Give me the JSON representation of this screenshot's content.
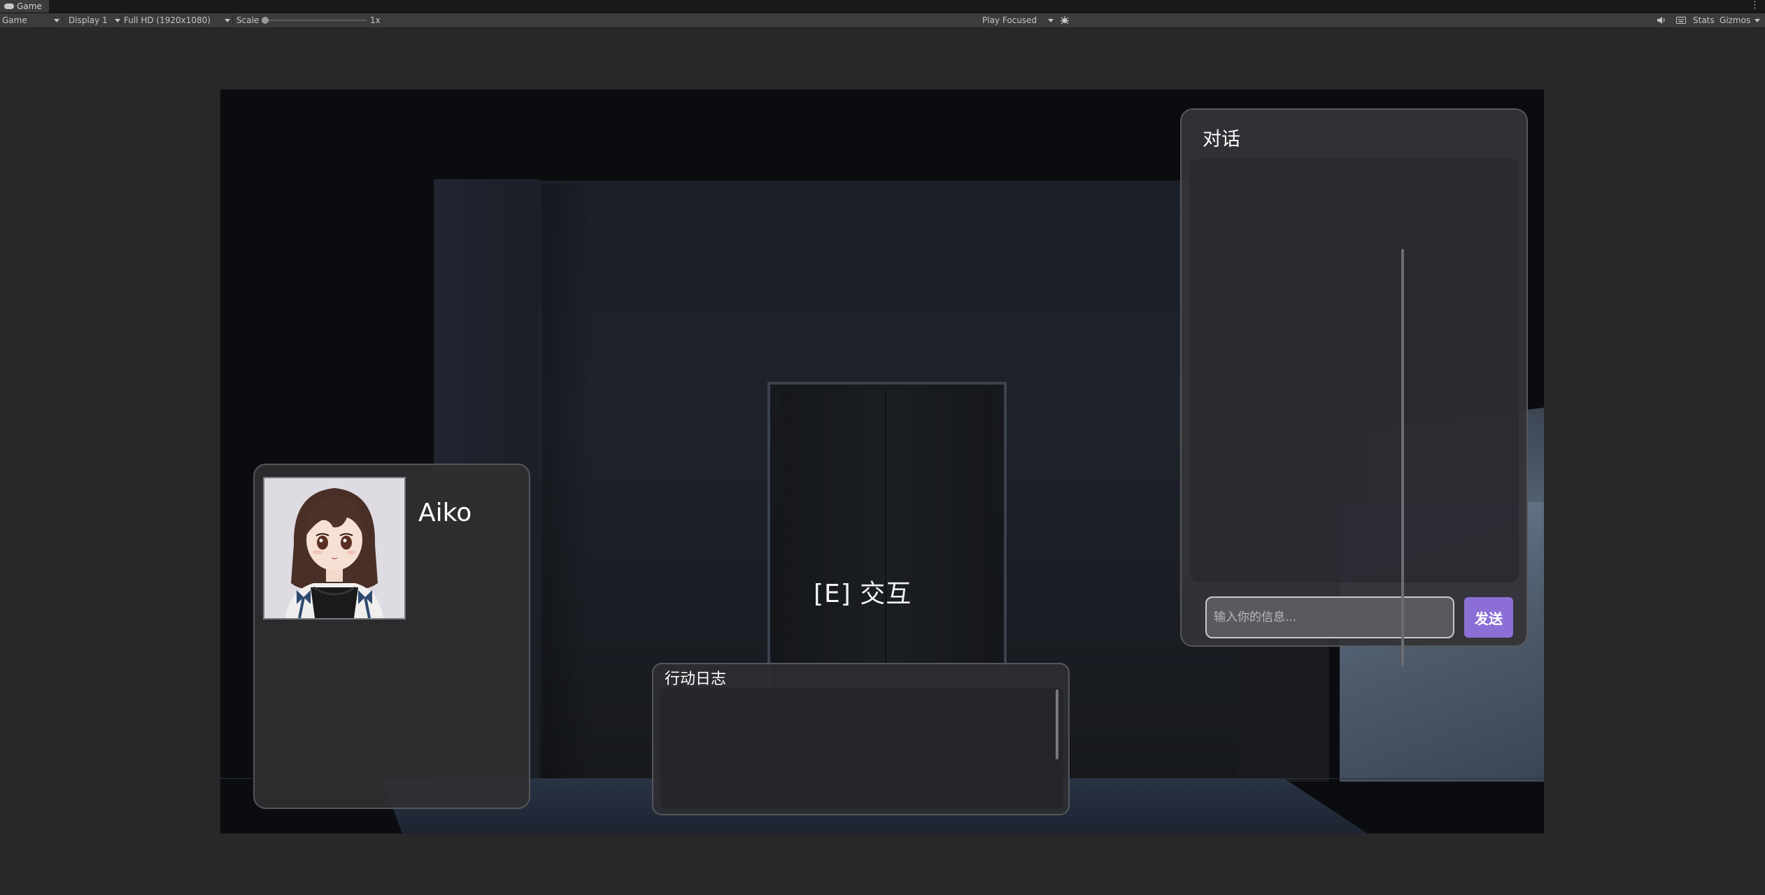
{
  "window": {
    "tab_title": "Game",
    "tab_icon": "gamepad-icon",
    "menu_glyph": "⋮"
  },
  "toolbar": {
    "view_mode": "Game",
    "display": "Display 1",
    "resolution": "Full HD (1920x1080)",
    "scale_label": "Scale",
    "scale_value": "1x",
    "play_mode": "Play Focused",
    "stats_label": "Stats",
    "gizmos_label": "Gizmos"
  },
  "game": {
    "interact_prompt": "[E] 交互",
    "character": {
      "name": "Aiko"
    },
    "chat": {
      "title": "对话",
      "input_placeholder": "输入你的信息...",
      "send_label": "发送"
    },
    "action_log": {
      "title": "行动日志"
    }
  },
  "colors": {
    "editor_bg": "#282828",
    "toolbar_bg": "#3c3c3c",
    "send_button": "#8c6fd6",
    "panel_border": "#56575c"
  }
}
